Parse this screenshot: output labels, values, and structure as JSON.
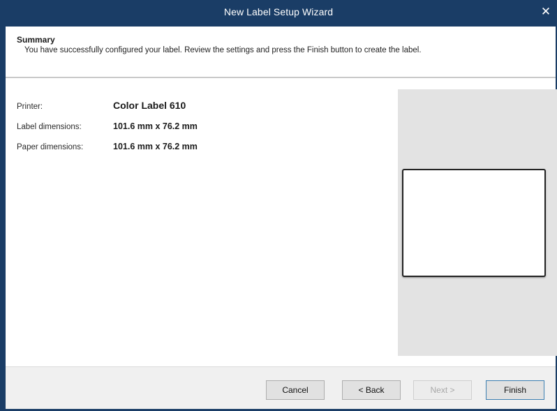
{
  "window": {
    "title": "New Label Setup Wizard",
    "close_glyph": "✕"
  },
  "header": {
    "title": "Summary",
    "description": "You have successfully configured your label. Review the settings and press the Finish button to create the label."
  },
  "summary": {
    "rows": [
      {
        "label": "Printer:",
        "value": "Color Label 610"
      },
      {
        "label": "Label dimensions:",
        "value": "101.6 mm x 76.2 mm"
      },
      {
        "label": "Paper dimensions:",
        "value": "101.6 mm x 76.2 mm"
      }
    ]
  },
  "buttons": {
    "cancel": "Cancel",
    "back": "< Back",
    "next": "Next >",
    "finish": "Finish"
  },
  "colors": {
    "titlebar": "#1a3d66",
    "preview_bg": "#e3e3e3",
    "footer_bg": "#f0f0f0"
  }
}
